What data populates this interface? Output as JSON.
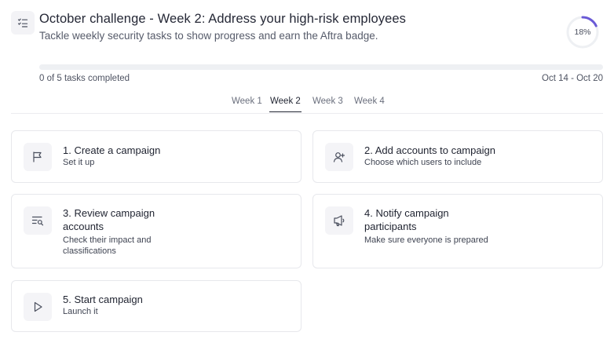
{
  "header": {
    "icon": "checklist-icon",
    "title": "October challenge - Week 2: Address your high-risk employees",
    "subtitle": "Tackle weekly security tasks to show progress and earn the Aftra badge.",
    "percent_label": "18%",
    "percent_value": 0.18
  },
  "progress": {
    "fraction": 0.0,
    "tasks_completed": "0 of 5 tasks completed",
    "date_range": "Oct 14 - Oct 20"
  },
  "tabs": [
    {
      "label": "Week 1",
      "active": false
    },
    {
      "label": "Week 2",
      "active": true
    },
    {
      "label": "Week 3",
      "active": false
    },
    {
      "label": "Week 4",
      "active": false
    }
  ],
  "tasks": [
    {
      "title": "1. Create a campaign",
      "description": "Set it up",
      "icon": "flag-icon"
    },
    {
      "title": "2. Add accounts to campaign",
      "description": "Choose which users to include",
      "icon": "add-user-icon"
    },
    {
      "title": "3. Review campaign accounts",
      "description": "Check their impact and classifications",
      "icon": "list-search-icon"
    },
    {
      "title": "4. Notify campaign participants",
      "description": "Make sure everyone is prepared",
      "icon": "megaphone-icon"
    },
    {
      "title": "5. Start campaign",
      "description": "Launch it",
      "icon": "play-icon"
    }
  ],
  "colors": {
    "accent": "#6a5ad6",
    "track": "#eef0f3"
  }
}
